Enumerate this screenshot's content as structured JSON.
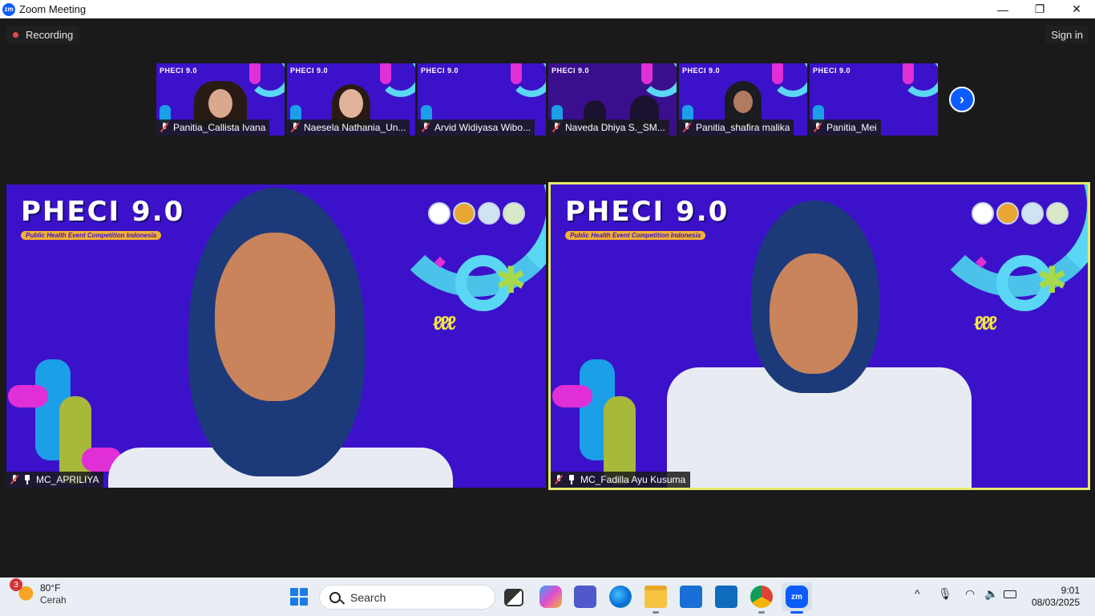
{
  "window": {
    "title": "Zoom Meeting",
    "minimize": "—",
    "maximize": "❐",
    "close": "✕"
  },
  "meeting_bar": {
    "recording_label": "Recording",
    "signin_label": "Sign in"
  },
  "thumbnails": [
    {
      "name": "Panitia_Callista Ivana",
      "muted": true
    },
    {
      "name": "Naesela Nathania_Un...",
      "muted": true
    },
    {
      "name": "Arvid Widiyasa Wibo...",
      "muted": true
    },
    {
      "name": "Naveda Dhiya S._SM...",
      "muted": true
    },
    {
      "name": "Panitia_shafira malika",
      "muted": true
    },
    {
      "name": "Panitia_Mei",
      "muted": true
    }
  ],
  "thumb_logo": "PHECI 9.0",
  "next_page_icon": "chevron-right-icon",
  "main_videos": [
    {
      "name": "MC_APRILIYA",
      "muted": true,
      "pinned": true,
      "active_speaker": false
    },
    {
      "name": "MC_Fadilla Ayu Kusuma",
      "muted": true,
      "pinned": true,
      "active_speaker": true
    }
  ],
  "background": {
    "event_title": "PHECI 9.0",
    "event_subtitle": "Public Health Event Competition Indonesia"
  },
  "taskbar": {
    "weather": {
      "badge": "3",
      "temp": "80°F",
      "condition": "Cerah"
    },
    "search_placeholder": "Search",
    "tray": {
      "chevron": "^"
    },
    "clock": {
      "time": "9:01",
      "date": "08/03/2025"
    }
  },
  "colors": {
    "accent": "#0b5cff",
    "video_bg": "#3b12c9",
    "active_speaker_border": "#e6e86e",
    "recording_dot": "#e5484d"
  }
}
